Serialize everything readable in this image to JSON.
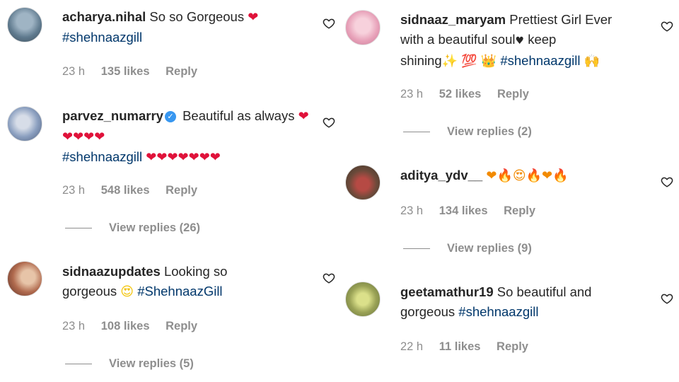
{
  "comments": [
    {
      "username": "acharya.nihal",
      "text": "So so Gorgeous",
      "emojis_inline": "❤",
      "hashtag": "#shehnaazgill",
      "time": "23 h",
      "likes": "135 likes",
      "reply": "Reply",
      "avatar_icon": "avatar-photo"
    },
    {
      "username": "parvez_numarry",
      "verified": true,
      "text": "Beautiful as always",
      "emojis_line1": "❤❤❤❤❤",
      "hashtag": "#shehnaazgill",
      "emojis_line2": "❤❤❤❤❤❤❤",
      "time": "23 h",
      "likes": "548 likes",
      "reply": "Reply",
      "view_replies": "View replies (26)"
    },
    {
      "username": "sidnaazupdates",
      "text_a": "Looking so",
      "text_b": "gorgeous",
      "emoji": "😍",
      "hashtag": "#ShehnaazGill",
      "time": "23 h",
      "likes": "108 likes",
      "reply": "Reply",
      "view_replies": "View replies (5)"
    },
    {
      "username": "sidnaaz_maryam",
      "text_a": "Prettiest Girl Ever",
      "text_b": "with a beautiful soul",
      "small_heart": "♥",
      "text_c": "keep",
      "text_d": "shining",
      "emojis": "✨",
      "emojis2": "💯",
      "emojis3": "👑",
      "hashtag": "#shehnaazgill",
      "emojis4": "🙌",
      "time": "23 h",
      "likes": "52 likes",
      "reply": "Reply",
      "view_replies": "View replies (2)"
    },
    {
      "username": "aditya_ydv__",
      "emojis": "❤🔥😍🔥❤🔥",
      "time": "23 h",
      "likes": "134 likes",
      "reply": "Reply",
      "view_replies": "View replies (9)"
    },
    {
      "username": "geetamathur19",
      "text_a": "So beautiful and",
      "text_b": "gorgeous",
      "hashtag": "#shehnaazgill",
      "time": "22 h",
      "likes": "11 likes",
      "reply": "Reply"
    }
  ],
  "icons": {
    "like": "heart-outline-icon",
    "verified": "verified-badge-icon"
  },
  "colors": {
    "hashtag": "#00376b",
    "meta": "#8e8e8e",
    "verified": "#3897f0"
  }
}
